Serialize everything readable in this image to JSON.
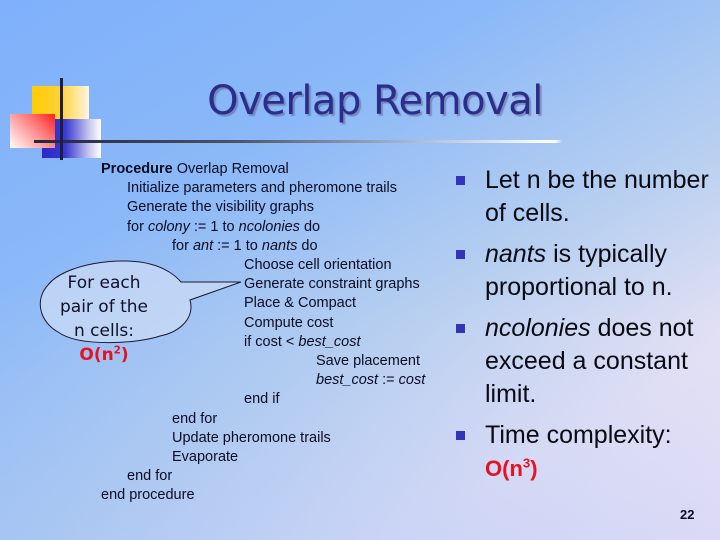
{
  "slide": {
    "title": "Overlap Removal",
    "page_number": "22",
    "accent_color": "#2c2c8a",
    "highlight_color": "#e8121e"
  },
  "pseudocode": {
    "line0": {
      "kw": "Procedure",
      "rest": " Overlap Removal"
    },
    "line1": "Initialize parameters and pheromone trails",
    "line2": "Generate the visibility graphs",
    "line3": {
      "a": "for ",
      "b": "colony",
      "c": " := 1 to ",
      "d": "ncolonies",
      "e": " do"
    },
    "line4": {
      "a": "for ",
      "b": "ant",
      "c": " := 1 to ",
      "d": "nants",
      "e": " do"
    },
    "line5": "Choose cell orientation",
    "line6": "Generate constraint graphs",
    "line7": "Place & Compact",
    "line8": "Compute cost",
    "line9": {
      "a": "if cost < ",
      "b": "best_cost"
    },
    "line10": "Save placement",
    "line11": {
      "a": "best_cost",
      "b": " := ",
      "c": "cost"
    },
    "line12": "end if",
    "line13": "end for",
    "line14": "Update pheromone trails",
    "line15": "Evaporate",
    "line16": "end for",
    "line17": "end procedure"
  },
  "callout": {
    "line1": "For each",
    "line2": "pair of the",
    "line3": "n cells:",
    "complexity_base": "O(n",
    "complexity_exp": "2",
    "complexity_close": ")"
  },
  "bullets": {
    "b1": "Let n be the number of cells.",
    "b2_italic": "nants",
    "b2_rest": " is typically proportional to n.",
    "b3_italic": "ncolonies",
    "b3_rest": " does not exceed a constant limit.",
    "b4": "Time complexity:",
    "b4_base": "O(n",
    "b4_exp": "3",
    "b4_close": ")"
  }
}
